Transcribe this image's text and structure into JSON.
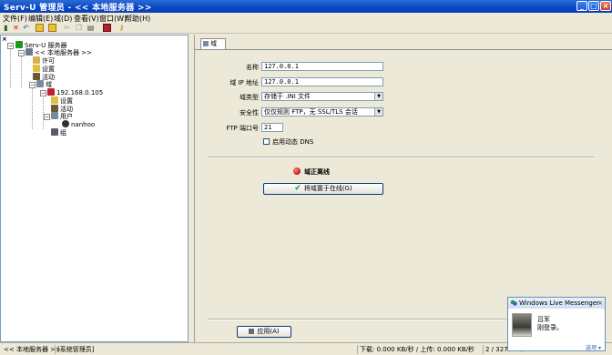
{
  "window": {
    "title": "Serv-U 管理员 - << 本地服务器 >>"
  },
  "menu": [
    "文件(F)",
    "编辑(E)",
    "域(D)",
    "查看(V)",
    "窗口(W)",
    "帮助(H)"
  ],
  "toolbar_icons": [
    "connect-icon",
    "delete-icon",
    "undo-icon",
    "open-folder-icon",
    "new-folder-icon",
    "cut-icon",
    "copy-icon",
    "paste-icon",
    "book-icon",
    "key-icon"
  ],
  "tree": {
    "server_root": "Serv-U 服务器",
    "local_server": "<< 本地服务器 >>",
    "license": "许可",
    "settings": "设置",
    "activity": "活动",
    "domains": "域",
    "domain_ip": "192.168.0.105",
    "domain_settings": "设置",
    "domain_activity": "活动",
    "users": "用户",
    "user_name": "nanhoo",
    "groups": "组"
  },
  "tab": {
    "label": "域"
  },
  "form": {
    "name_label": "名称",
    "name_value": "127.0.0.1",
    "ip_label": "域 IP 地址",
    "ip_value": "127.0.0.1",
    "type_label": "域类型",
    "type_value": "存储于 .INI 文件",
    "security_label": "安全性",
    "security_value": "仅仅规则 FTP，无 SSL/TLS 会话",
    "port_label": "FTP 端口号",
    "port_value": "21",
    "dynamic_dns_label": "启用动态 DNS"
  },
  "status": {
    "state_text": "域正离线",
    "online_button": "将域置于在线(G)"
  },
  "apply_button": "应用(A)",
  "statusbar": {
    "server": "<< 本地服务器 >>",
    "role": "[系统管理员]",
    "transfer": "下载: 0.000 KB/秒 / 上传: 0.000 KB/秒",
    "counter": "2 / 32767 个"
  },
  "messenger": {
    "title": "Windows Live Messenger",
    "contact": "吕军",
    "message": "刚登录。",
    "options": "选项"
  },
  "colors": {
    "titlebar": "#0b46c4",
    "face": "#ece9d8",
    "status_red": "#c01010",
    "check_green": "#1a9a1a"
  }
}
